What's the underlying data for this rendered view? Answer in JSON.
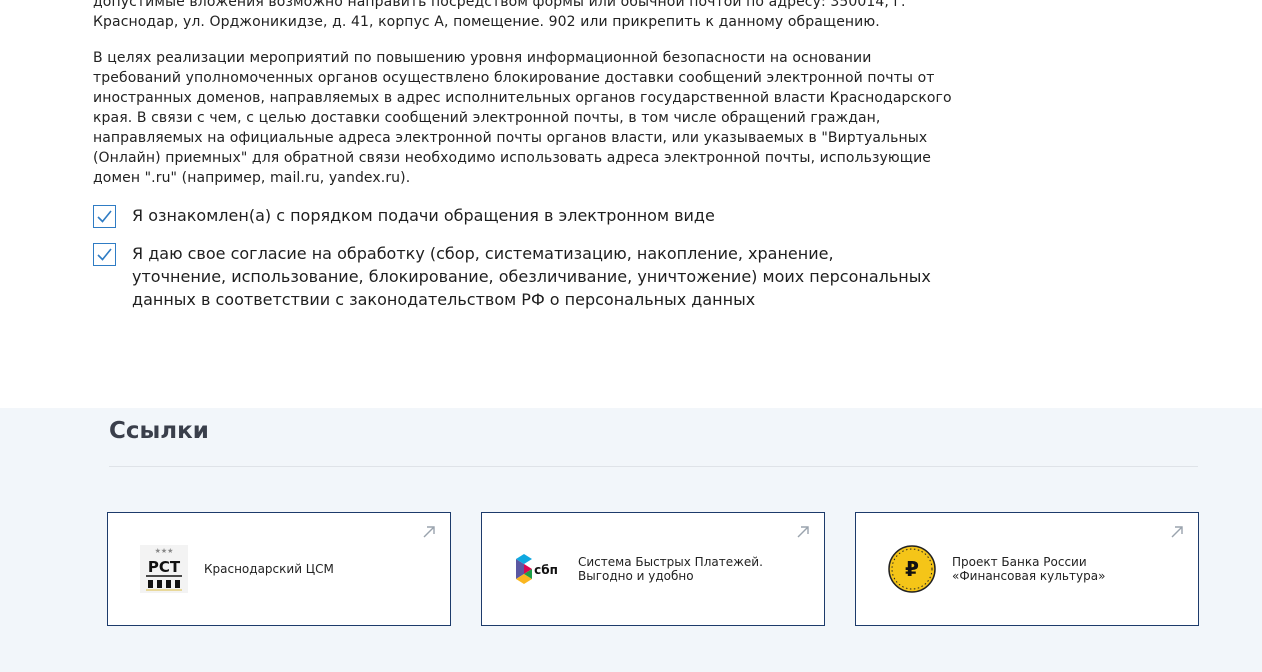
{
  "notice": {
    "paragraph1": "допустимые вложения возможно направить посредством формы или обычной почтой по адресу: 350014, г. Краснодар, ул. Орджоникидзе, д. 41, корпус А, помещение. 902 или прикрепить к данному обращению.",
    "paragraph2": "В целях реализации мероприятий по повышению уровня информационной безопасности на основании требований уполномоченных органов осуществлено блокирование доставки сообщений электронной почты от иностранных доменов, направляемых в адрес исполнительных органов государственной власти Краснодарского края. В связи с чем, с целью доставки сообщений электронной почты, в том числе обращений граждан, направляемых на официальные адреса электронной почты органов власти, или указываемых в \"Виртуальных (Онлайн) приемных\" для обратной связи необходимо использовать адреса электронной почты, использующие домен \".ru\" (например, mail.ru, yandex.ru)."
  },
  "consents": [
    {
      "label": "Я ознакомлен(а) с порядком подачи обращения в электронном виде",
      "checked": true
    },
    {
      "label": "Я даю свое согласие на обработку (сбор, систематизацию, накопление, хранение, уточнение, использование, блокирование, обезличивание, уничтожение) моих персональных данных в соответствии с законодательством РФ о персональных данных",
      "checked": true
    }
  ],
  "links": {
    "title": "Ссылки",
    "cards": [
      {
        "label": "Краснодарский ЦСМ",
        "logo_text": "РСТ",
        "icon": "rst-logo-icon"
      },
      {
        "label": "Система Быстрых Платежей. Выгодно и удобно",
        "logo_text": "сбп",
        "icon": "sbp-logo-icon"
      },
      {
        "label": "Проект Банка России «Финансовая культура»",
        "logo_text": "₽",
        "icon": "ruble-coin-icon"
      }
    ]
  },
  "colors": {
    "accent": "#2f7cc4",
    "card_border": "#1d3b6b",
    "section_bg": "#f2f6fa",
    "coin": "#f5c518"
  }
}
